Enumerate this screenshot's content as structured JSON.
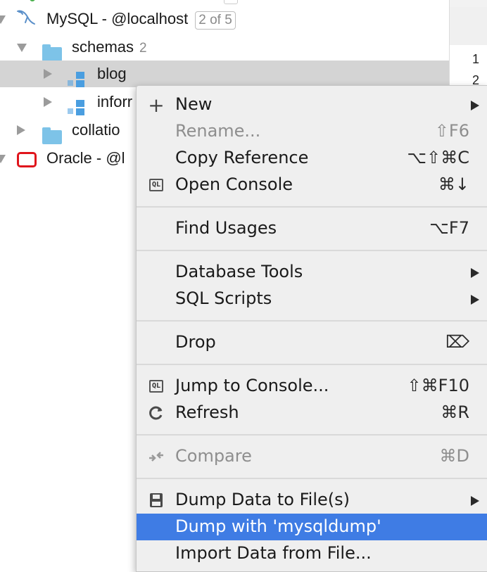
{
  "tree": {
    "rows": [
      {
        "label": "MySQL - @localhost",
        "badge": "2 of 5"
      },
      {
        "label": "schemas",
        "count": "2"
      },
      {
        "label": "blog"
      },
      {
        "label": "inforr"
      },
      {
        "label": "collatio"
      },
      {
        "label": "Oracle - @l"
      }
    ]
  },
  "editor": {
    "line_numbers": [
      "1",
      "2"
    ]
  },
  "context_menu": {
    "items": [
      {
        "label": "New",
        "shortcut": "",
        "icon": "plus-icon",
        "submenu": true
      },
      {
        "label": "Rename...",
        "shortcut": "⇧F6",
        "disabled": true
      },
      {
        "label": "Copy Reference",
        "shortcut": "⌥⇧⌘C"
      },
      {
        "label": "Open Console",
        "shortcut": "⌘↓",
        "icon": "console-icon",
        "icon_text": "QL"
      },
      {
        "label": "Find Usages",
        "shortcut": "⌥F7"
      },
      {
        "label": "Database Tools",
        "submenu": true
      },
      {
        "label": "SQL Scripts",
        "submenu": true
      },
      {
        "label": "Drop",
        "shortcut": "⌦"
      },
      {
        "label": "Jump to Console...",
        "shortcut": "⇧⌘F10",
        "icon": "console-icon",
        "icon_text": "QL"
      },
      {
        "label": "Refresh",
        "shortcut": "⌘R",
        "icon": "refresh-icon"
      },
      {
        "label": "Compare",
        "shortcut": "⌘D",
        "disabled": true,
        "icon": "compare-icon"
      },
      {
        "label": "Dump Data to File(s)",
        "submenu": true,
        "icon": "save-icon"
      },
      {
        "label": "Dump with 'mysqldump'",
        "highlighted": true
      },
      {
        "label": "Import Data from File..."
      }
    ]
  },
  "colors": {
    "highlight": "#3f7ce4",
    "folder": "#7dc3e8",
    "schema": "#4a9ee0",
    "oracle": "#e0151c"
  }
}
